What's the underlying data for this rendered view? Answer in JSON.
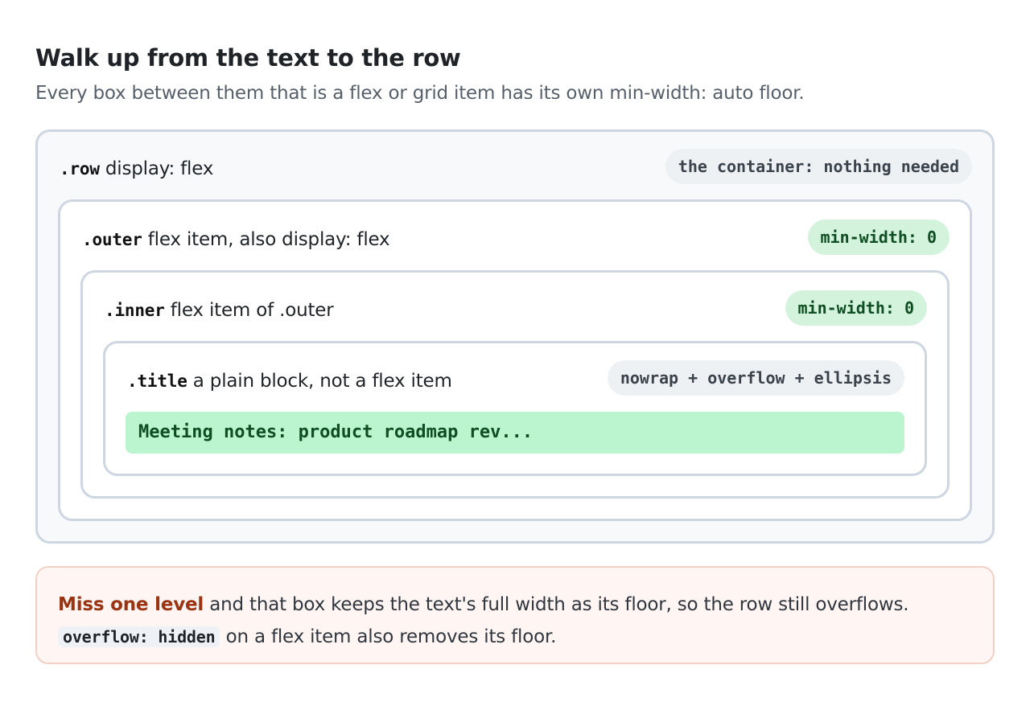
{
  "header": {
    "title": "Walk up from the text to the row",
    "subtitle": "Every box between them that is a flex or grid item has its own min-width: auto floor."
  },
  "boxes": {
    "row": {
      "selector": ".row",
      "description": " display: flex",
      "pill": "the container: nothing needed"
    },
    "outer": {
      "selector": ".outer",
      "description": " flex item, also display: flex",
      "pill": "min-width: 0"
    },
    "inner": {
      "selector": ".inner",
      "description": " flex item of .outer",
      "pill": "min-width: 0"
    },
    "title": {
      "selector": ".title",
      "description": " a plain block, not a flex item",
      "pill": "nowrap + overflow + ellipsis"
    }
  },
  "demo_text": "Meeting notes: product roadmap rev...",
  "note": {
    "emphasis": "Miss one level",
    "line1_rest": " and that box keeps the text's full width as its floor, so the row still overflows.",
    "code": "overflow: hidden",
    "line2_rest": " on a flex item also removes its floor."
  },
  "colors": {
    "border": "#cdd6e1",
    "pill_gray": "#eef1f4",
    "pill_green": "#d4f3dd",
    "demo_bg": "#baf5d0",
    "warn_text": "#9a3412",
    "note_bg": "#fff6f4"
  }
}
